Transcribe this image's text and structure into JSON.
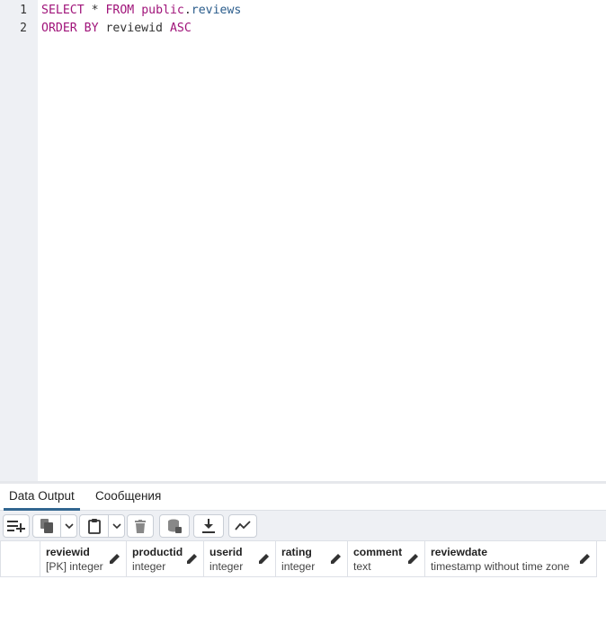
{
  "editor": {
    "line_numbers": [
      "1",
      "2"
    ],
    "line1": {
      "select": "SELECT",
      "star": " * ",
      "from": "FROM",
      "space": " ",
      "schema": "public",
      "dot": ".",
      "table": "reviews"
    },
    "line2": {
      "order_by": "ORDER BY",
      "space": " ",
      "column": "reviewid",
      "space2": " ",
      "asc": "ASC"
    }
  },
  "tabs": [
    {
      "label": "Data Output",
      "active": true
    },
    {
      "label": "Сообщения",
      "active": false
    }
  ],
  "toolbar": {
    "buttons": [
      "add-row-icon",
      "copy-icon",
      "chevron-down-icon",
      "paste-icon",
      "chevron-down-icon",
      "trash-icon",
      "save-data-icon",
      "download-icon",
      "graph-icon"
    ]
  },
  "columns": [
    {
      "name": "reviewid",
      "type": "[PK] integer"
    },
    {
      "name": "productid",
      "type": "integer"
    },
    {
      "name": "userid",
      "type": "integer"
    },
    {
      "name": "rating",
      "type": "integer"
    },
    {
      "name": "comment",
      "type": "text"
    },
    {
      "name": "reviewdate",
      "type": "timestamp without time zone"
    }
  ],
  "colors": {
    "keyword": "#a0147a",
    "table": "#2b5d8c",
    "tab_active": "#326690"
  }
}
